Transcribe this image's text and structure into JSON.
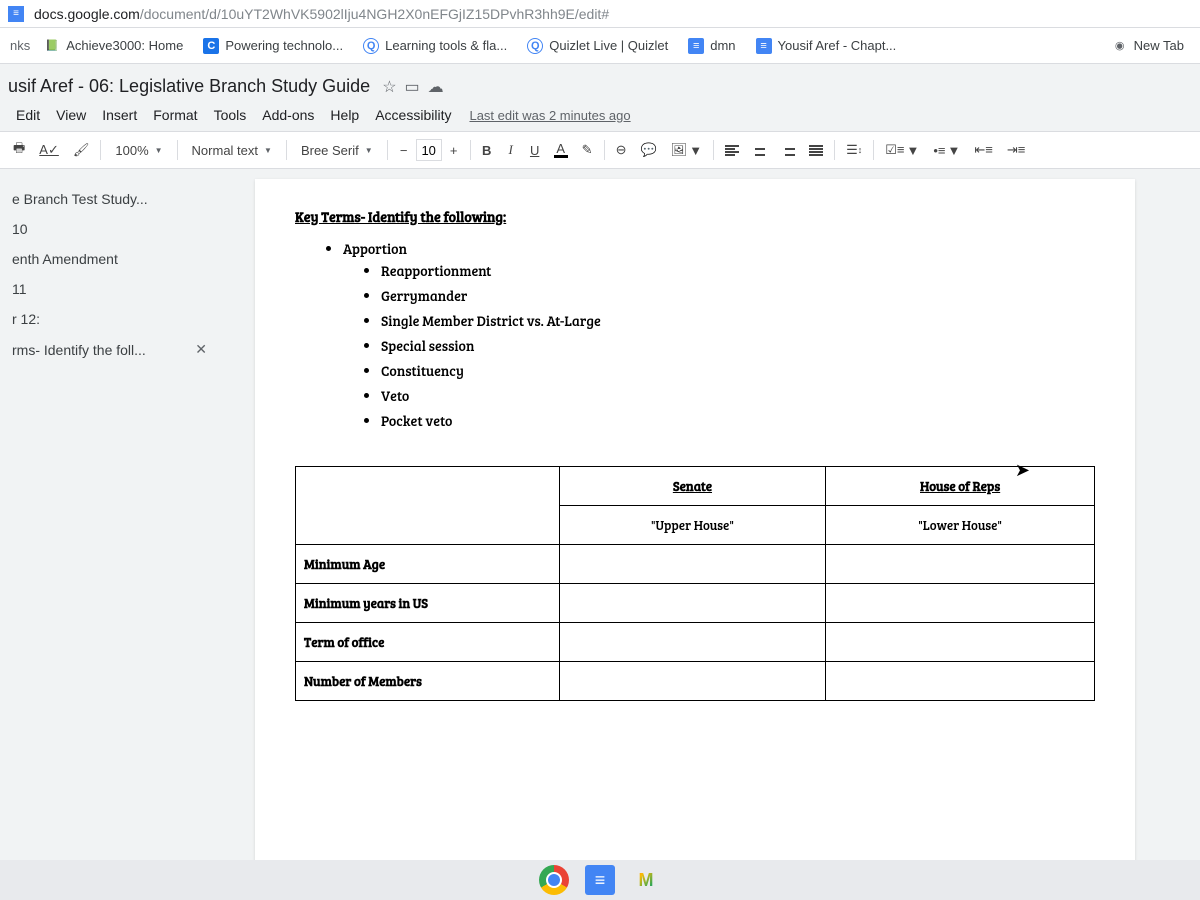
{
  "url": {
    "host": "docs.google.com",
    "path": "/document/d/10uYT2WhVK5902lIju4NGH2X0nEFGjIZ15DPvhR3hh9E/edit#"
  },
  "bookmarks": {
    "prefix": "nks",
    "items": [
      {
        "label": "Achieve3000: Home",
        "icon": "📗",
        "bg": "#fff"
      },
      {
        "label": "Powering technolo...",
        "icon": "C",
        "bg": "#1a73e8"
      },
      {
        "label": "Learning tools & fla...",
        "icon": "Q",
        "bg": "#fff"
      },
      {
        "label": "Quizlet Live | Quizlet",
        "icon": "Q",
        "bg": "#fff"
      },
      {
        "label": "dmn",
        "icon": "≡",
        "bg": "#4285f4"
      },
      {
        "label": "Yousif Aref - Chapt...",
        "icon": "≡",
        "bg": "#4285f4"
      }
    ],
    "newtab": "New Tab"
  },
  "doc": {
    "title": "usif Aref - 06: Legislative Branch Study Guide",
    "menus": [
      "Edit",
      "View",
      "Insert",
      "Format",
      "Tools",
      "Add-ons",
      "Help",
      "Accessibility"
    ],
    "last_edit": "Last edit was 2 minutes ago"
  },
  "toolbar": {
    "zoom": "100%",
    "style": "Normal text",
    "font": "Bree Serif",
    "size": "10",
    "bold": "B",
    "italic": "I",
    "underline": "U",
    "textcolor": "A"
  },
  "outline": [
    {
      "label": "e Branch Test Study..."
    },
    {
      "label": "10"
    },
    {
      "label": "enth Amendment"
    },
    {
      "label": "11"
    },
    {
      "label": "r 12:"
    },
    {
      "label": "rms- Identify the foll...",
      "close": true
    }
  ],
  "content": {
    "heading": "Key Terms- Identify the following:",
    "terms": [
      "Apportion",
      "Reapportionment",
      "Gerrymander",
      "Single Member District vs. At-Large",
      "Special session",
      "Constituency",
      "Veto",
      "Pocket veto"
    ],
    "table": {
      "col1_header": "Senate",
      "col1_sub": "\"Upper House\"",
      "col2_header": "House of Reps",
      "col2_sub": "\"Lower House\"",
      "rows": [
        "Minimum Age",
        "Minimum years in US",
        "Term of office",
        "Number of Members"
      ]
    }
  }
}
